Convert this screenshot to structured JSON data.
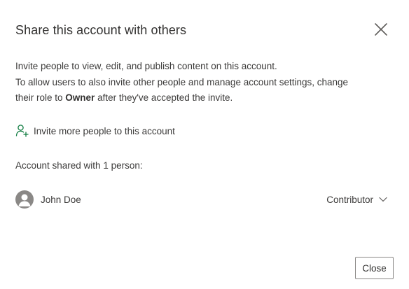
{
  "dialog": {
    "title": "Share this account with others",
    "close_icon": "close-icon",
    "description": {
      "line1": "Invite people to view, edit, and publish content on this account.",
      "line2": "To allow users to also invite other people and manage account settings, change",
      "line3_before": "their role to ",
      "line3_bold": "Owner",
      "line3_after": " after they've accepted the invite."
    },
    "invite": {
      "icon": "add-person-icon",
      "label": "Invite more people to this account"
    },
    "shared_with": "Account shared with 1 person:",
    "people": [
      {
        "avatar": "person-avatar-icon",
        "name": "John Doe",
        "role": "Contributor",
        "role_icon": "chevron-down-icon"
      }
    ],
    "close_button": "Close"
  },
  "colors": {
    "accent_green": "#107c41",
    "text": "#323130",
    "avatar_bg": "#8a8886"
  }
}
